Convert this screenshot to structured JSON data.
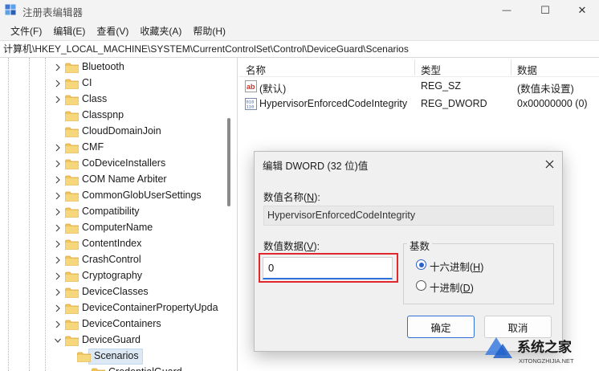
{
  "window": {
    "title": "注册表编辑器",
    "minimize_glyph": "—",
    "maximize_glyph": "☐",
    "close_glyph": "✕"
  },
  "menu": [
    "文件(F)",
    "编辑(E)",
    "查看(V)",
    "收藏夹(A)",
    "帮助(H)"
  ],
  "address": "计算机\\HKEY_LOCAL_MACHINE\\SYSTEM\\CurrentControlSet\\Control\\DeviceGuard\\Scenarios",
  "tree": {
    "items": [
      {
        "label": "Bluetooth"
      },
      {
        "label": "CI"
      },
      {
        "label": "Class"
      },
      {
        "label": "Classpnp"
      },
      {
        "label": "CloudDomainJoin"
      },
      {
        "label": "CMF"
      },
      {
        "label": "CoDeviceInstallers"
      },
      {
        "label": "COM Name Arbiter"
      },
      {
        "label": "CommonGlobUserSettings"
      },
      {
        "label": "Compatibility"
      },
      {
        "label": "ComputerName"
      },
      {
        "label": "ContentIndex"
      },
      {
        "label": "CrashControl"
      },
      {
        "label": "Cryptography"
      },
      {
        "label": "DeviceClasses"
      },
      {
        "label": "DeviceContainerPropertyUpda"
      },
      {
        "label": "DeviceContainers"
      },
      {
        "label": "DeviceGuard"
      }
    ],
    "selected": "Scenarios",
    "partial_child": "CredentialGuard"
  },
  "list": {
    "headers": {
      "name": "名称",
      "type": "类型",
      "data": "数据"
    },
    "rows": [
      {
        "icon": "string-value-icon",
        "name": "(默认)",
        "type": "REG_SZ",
        "data": "(数值未设置)"
      },
      {
        "icon": "binary-value-icon",
        "name": "HypervisorEnforcedCodeIntegrity",
        "type": "REG_DWORD",
        "data": "0x00000000 (0)"
      }
    ]
  },
  "dialog": {
    "title": "编辑 DWORD (32 位)值",
    "name_label": "数值名称(N):",
    "name_value": "HypervisorEnforcedCodeIntegrity",
    "data_label": "数值数据(V):",
    "data_value": "0",
    "base_label": "基数",
    "hex_label": "十六进制(H)",
    "dec_label": "十进制(D)",
    "base_selected": "hex",
    "ok_label": "确定",
    "cancel_label": "取消"
  },
  "watermark": {
    "text": "系统之家",
    "url_text": "XITONGZHIJIA.NET"
  },
  "colors": {
    "accent": "#2f6fd8",
    "highlight_box": "#e0282e",
    "folder": "#f2c55c",
    "selection": "#dde8f5"
  }
}
